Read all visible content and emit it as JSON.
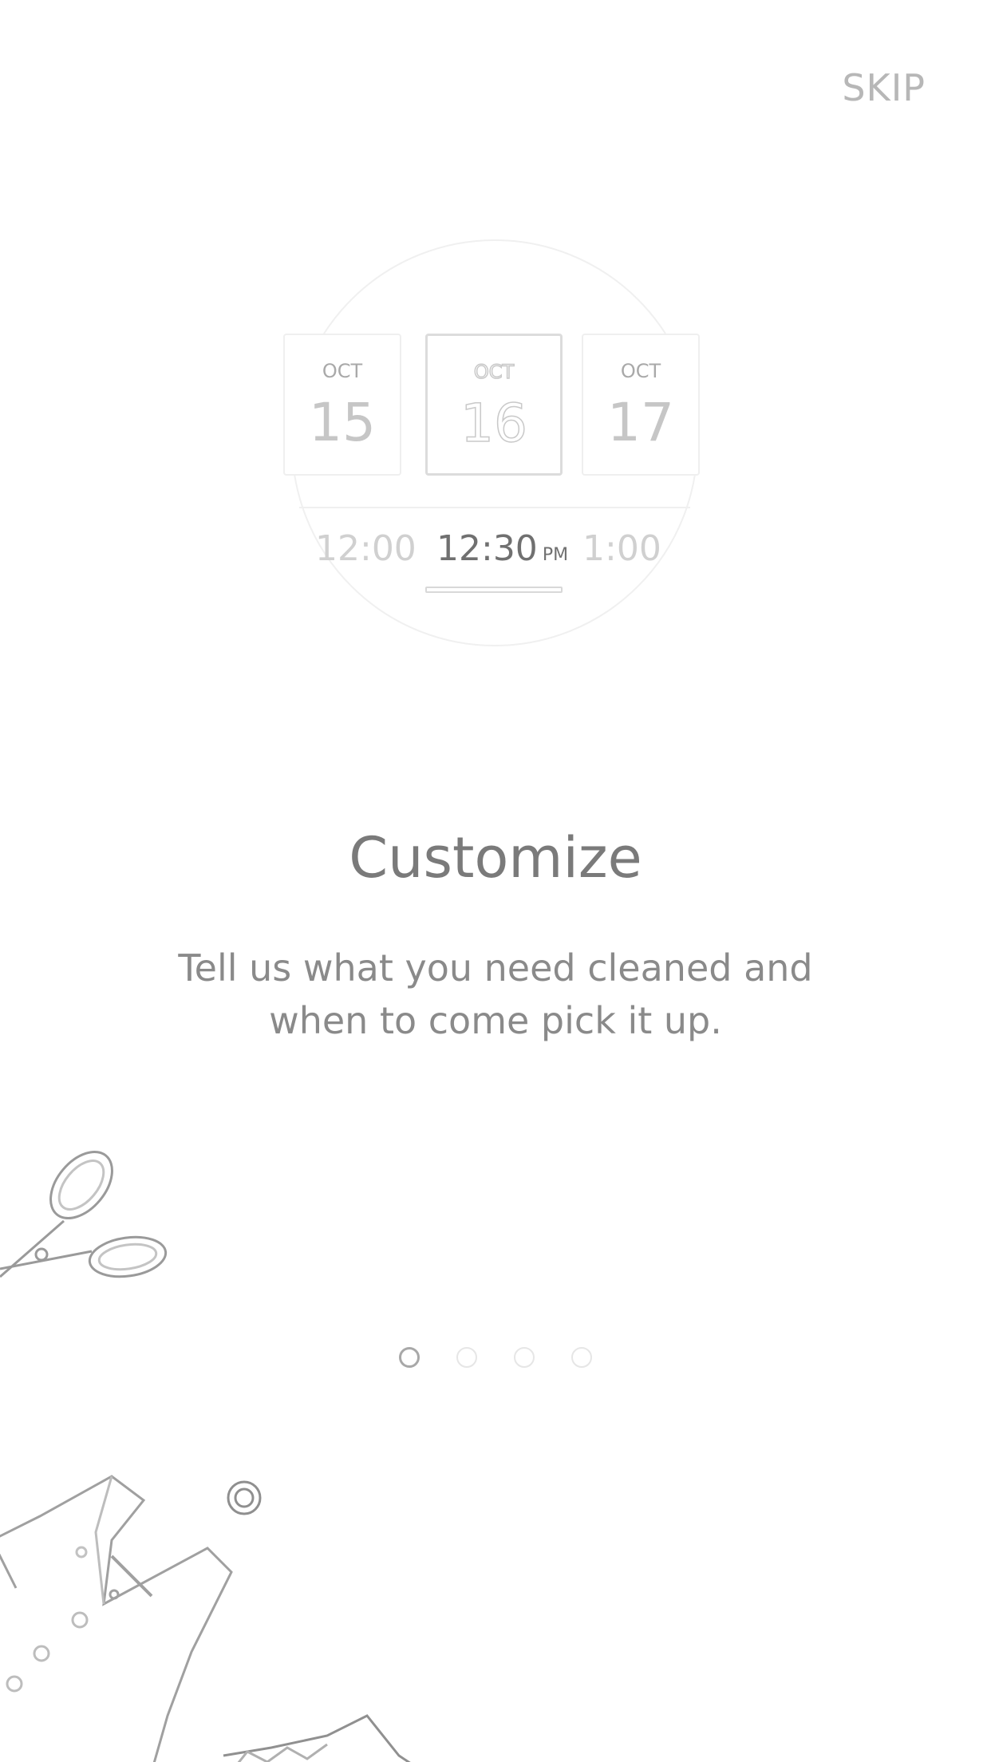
{
  "header": {
    "skip_label": "SKIP"
  },
  "picker": {
    "dates": [
      {
        "month": "OCT",
        "day": "15"
      },
      {
        "month": "OCT",
        "day": "16",
        "selected": true
      },
      {
        "month": "OCT",
        "day": "17"
      }
    ],
    "times": [
      {
        "label": "12:00"
      },
      {
        "label": "12:30",
        "suffix": "PM",
        "selected": true
      },
      {
        "label": "1:00"
      }
    ]
  },
  "content": {
    "title": "Customize",
    "description_line1": "Tell us what you need cleaned and",
    "description_line2": "when to come pick it up."
  },
  "pager": {
    "page_count": 4,
    "current_page": 1
  },
  "decor": {
    "icons": [
      "scissors-icon",
      "shirt-icon",
      "button-icon"
    ]
  },
  "colors": {
    "background": "#ffffff",
    "title_text": "#7a7a7a",
    "body_text": "#8a8a8a",
    "muted_text": "#b7b7b7",
    "dot_active": "#a8a8a8",
    "dot_inactive": "#e6e6e6"
  }
}
